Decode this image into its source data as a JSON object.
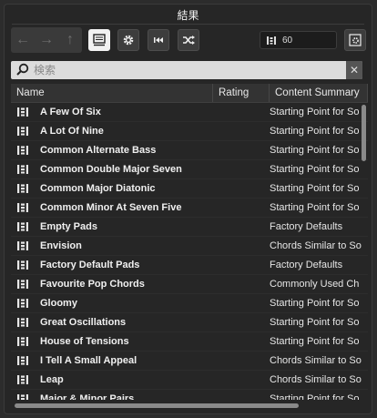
{
  "window": {
    "title": "結果"
  },
  "toolbar": {
    "back_glyph": "←",
    "forward_glyph": "→",
    "up_glyph": "↑",
    "result_count": "60",
    "icons": [
      "arrow-left-icon",
      "arrow-right-icon",
      "arrow-up-icon",
      "list-view-icon",
      "gear-icon",
      "rewind-icon",
      "shuffle-icon",
      "settings-icon"
    ]
  },
  "search": {
    "placeholder": "検索",
    "value": "",
    "clear_glyph": "✕"
  },
  "table": {
    "columns": [
      "Name",
      "Rating",
      "Content Summary"
    ],
    "rows": [
      {
        "name": "A Few Of Six",
        "rating": "",
        "summary": "Starting Point for So"
      },
      {
        "name": "A Lot Of Nine",
        "rating": "",
        "summary": "Starting Point for So"
      },
      {
        "name": "Common Alternate Bass",
        "rating": "",
        "summary": "Starting Point for So"
      },
      {
        "name": "Common Double Major Seven",
        "rating": "",
        "summary": "Starting Point for So"
      },
      {
        "name": "Common Major Diatonic",
        "rating": "",
        "summary": "Starting Point for So"
      },
      {
        "name": "Common Minor At Seven Five",
        "rating": "",
        "summary": "Starting Point for So"
      },
      {
        "name": "Empty Pads",
        "rating": "",
        "summary": "Factory Defaults"
      },
      {
        "name": "Envision",
        "rating": "",
        "summary": "Chords Similar to So"
      },
      {
        "name": "Factory Default Pads",
        "rating": "",
        "summary": "Factory Defaults"
      },
      {
        "name": "Favourite Pop Chords",
        "rating": "",
        "summary": "Commonly Used Ch"
      },
      {
        "name": "Gloomy",
        "rating": "",
        "summary": "Starting Point for So"
      },
      {
        "name": "Great Oscillations",
        "rating": "",
        "summary": "Starting Point for So"
      },
      {
        "name": "House of Tensions",
        "rating": "",
        "summary": "Starting Point for So"
      },
      {
        "name": "I Tell A Small Appeal",
        "rating": "",
        "summary": "Chords Similar to So"
      },
      {
        "name": "Leap",
        "rating": "",
        "summary": "Chords Similar to So"
      },
      {
        "name": "Major & Minor Pairs",
        "rating": "",
        "summary": "Starting Point for So"
      }
    ]
  }
}
